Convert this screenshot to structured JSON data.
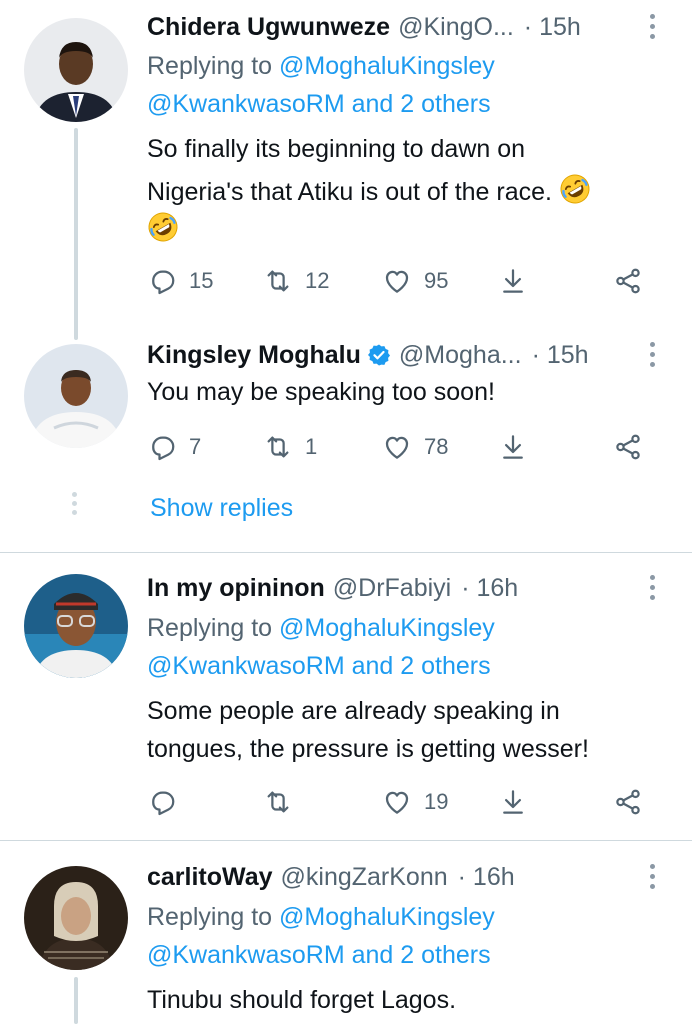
{
  "tweets": [
    {
      "name": "Chidera Ugwunweze",
      "handle": "@KingO...",
      "time": "· 15h",
      "replying_prefix": "Replying to ",
      "replying_user": "@MoghaluKingsley",
      "replying_more": "@KwankwasoRM and 2 others",
      "text_line1": "So finally its beginning to dawn on",
      "text_line2": "Nigeria's that Atiku is out of the race.",
      "replies": "15",
      "retweets": "12",
      "likes": "95"
    },
    {
      "name": "Kingsley Moghalu",
      "handle": "@Mogha...",
      "time": "· 15h",
      "text_line1": "You may be speaking too soon!",
      "replies": "7",
      "retweets": "1",
      "likes": "78",
      "show_replies": "Show replies"
    },
    {
      "name": "In my opininon",
      "handle": "@DrFabiyi",
      "time": "· 16h",
      "replying_prefix": "Replying to ",
      "replying_user": "@MoghaluKingsley",
      "replying_more": "@KwankwasoRM and 2 others",
      "text_line1": "Some people are already speaking in",
      "text_line2": "tongues, the pressure is getting wesser!",
      "likes": "19"
    },
    {
      "name": "carlitoWay",
      "handle": "@kingZarKonn",
      "time": "· 16h",
      "replying_prefix": "Replying to ",
      "replying_user": "@MoghaluKingsley",
      "replying_more": "@KwankwasoRM and 2 others",
      "text_line1": "Tinubu should forget Lagos."
    }
  ],
  "icons": {
    "reply": "reply-icon",
    "retweet": "retweet-icon",
    "like": "heart-icon",
    "download": "download-icon",
    "share": "share-icon",
    "more": "more-icon",
    "verified": "verified-badge-icon",
    "emoji": "rofl-emoji-icon"
  },
  "colors": {
    "link": "#1d9bf0",
    "secondary_text": "#536471",
    "primary_text": "#0f1419",
    "divider": "#cfd9de"
  }
}
